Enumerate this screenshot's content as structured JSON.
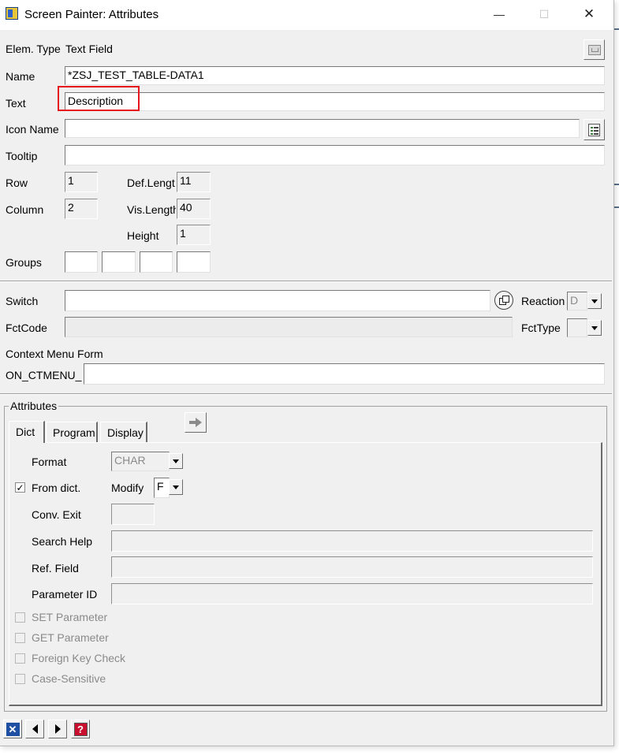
{
  "window": {
    "title": "Screen Painter: Attributes",
    "minimize_glyph": "—",
    "maximize_glyph": "☐",
    "close_glyph": "✕"
  },
  "top": {
    "elem_type_label": "Elem. Type",
    "elem_type_value": "Text Field",
    "name_label": "Name",
    "name_value": "*ZSJ_TEST_TABLE-DATA1",
    "text_label": "Text",
    "text_value": "Description",
    "icon_name_label": "Icon Name",
    "icon_name_value": "",
    "tooltip_label": "Tooltip",
    "tooltip_value": "",
    "row_label": "Row",
    "row_value": "1",
    "column_label": "Column",
    "column_value": "2",
    "def_length_label": "Def.Lengt",
    "def_length_value": "11",
    "vis_length_label": "Vis.Length",
    "vis_length_value": "40",
    "height_label": "Height",
    "height_value": "1",
    "groups_label": "Groups",
    "groups_values": [
      "",
      "",
      "",
      ""
    ]
  },
  "middle": {
    "switch_label": "Switch",
    "switch_value": "",
    "reaction_label": "Reaction",
    "reaction_value": "D",
    "fctcode_label": "FctCode",
    "fctcode_value": "",
    "fcttype_label": "FctType",
    "fcttype_value": "",
    "context_menu_label": "Context Menu Form",
    "ctmenu_prefix": "ON_CTMENU_",
    "ctmenu_value": ""
  },
  "attributes": {
    "group_label": "Attributes",
    "tabs": [
      {
        "label": "Dict",
        "active": true
      },
      {
        "label": "Program",
        "active": false
      },
      {
        "label": "Display",
        "active": false
      }
    ],
    "format_label": "Format",
    "format_value": "CHAR",
    "from_dict_label": "From dict.",
    "from_dict_checked": true,
    "check_glyph": "✓",
    "modify_label": "Modify",
    "modify_value": "F",
    "conv_exit_label": "Conv. Exit",
    "conv_exit_value": "",
    "search_help_label": "Search Help",
    "search_help_value": "",
    "ref_field_label": "Ref. Field",
    "ref_field_value": "",
    "parameter_id_label": "Parameter ID",
    "parameter_id_value": "",
    "set_parameter_label": "SET Parameter",
    "get_parameter_label": "GET Parameter",
    "foreign_key_label": "Foreign Key Check",
    "case_sensitive_label": "Case-Sensitive"
  },
  "colors": {
    "highlight_red": "#e8141b",
    "sap_blue": "#1f4fa3",
    "help_red": "#c8102e"
  }
}
